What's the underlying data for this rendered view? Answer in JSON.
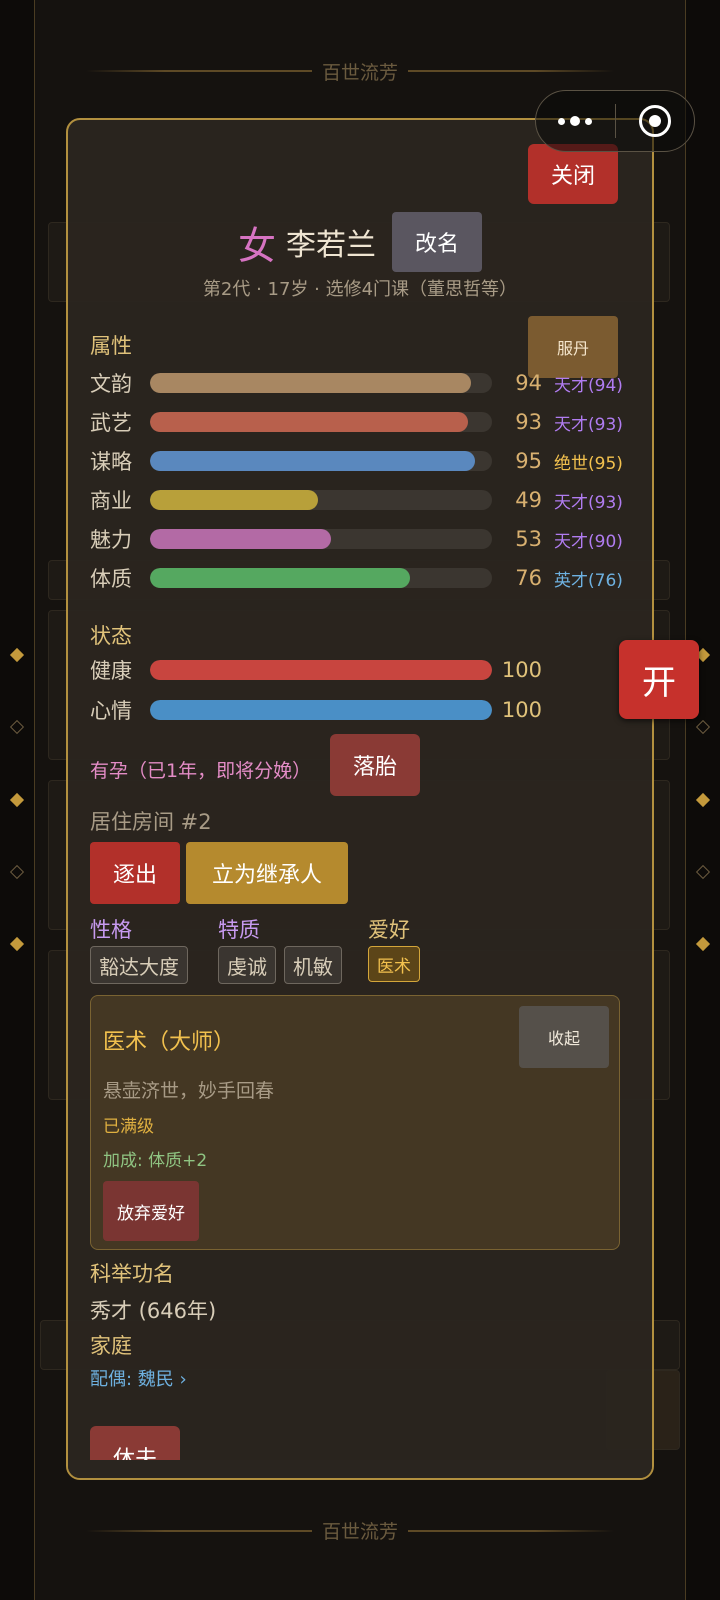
{
  "background": {
    "title_top": "百世流芳",
    "title_bottom": "百世流芳"
  },
  "open_button": {
    "label": "开"
  },
  "modal": {
    "close_label": "关闭",
    "gender": "女",
    "name": "李若兰",
    "rename_label": "改名",
    "subinfo": "第2代 · 17岁 · 选修4门课（董思哲等）",
    "attributes_label": "属性",
    "pill_label": "服丹",
    "attributes": [
      {
        "name": "文韵",
        "value": "94",
        "fill": 0.94,
        "color": "#a88762",
        "tag": "天才(94)",
        "tag_color": "#b07cf0"
      },
      {
        "name": "武艺",
        "value": "93",
        "fill": 0.93,
        "color": "#b8604c",
        "tag": "天才(93)",
        "tag_color": "#b07cf0"
      },
      {
        "name": "谋略",
        "value": "95",
        "fill": 0.95,
        "color": "#5a88be",
        "tag": "绝世(95)",
        "tag_color": "#f2c14e"
      },
      {
        "name": "商业",
        "value": "49",
        "fill": 0.49,
        "color": "#b8a03a",
        "tag": "天才(93)",
        "tag_color": "#b07cf0"
      },
      {
        "name": "魅力",
        "value": "53",
        "fill": 0.53,
        "color": "#b36aa5",
        "tag": "天才(90)",
        "tag_color": "#b07cf0"
      },
      {
        "name": "体质",
        "value": "76",
        "fill": 0.76,
        "color": "#55a860",
        "tag": "英才(76)",
        "tag_color": "#6eb1e0"
      }
    ],
    "status_label": "状态",
    "status": [
      {
        "name": "健康",
        "value": "100",
        "fill": 1.0,
        "color": "#c8453f"
      },
      {
        "name": "心情",
        "value": "100",
        "fill": 1.0,
        "color": "#4a8fc6"
      }
    ],
    "pregnancy": "有孕（已1年，即将分娩）",
    "abort_label": "落胎",
    "room": "居住房间 #2",
    "expel_label": "逐出",
    "heir_label": "立为继承人",
    "personality_label": "性格",
    "traits_label": "特质",
    "hobby_label": "爱好",
    "personality": [
      "豁达大度"
    ],
    "traits": [
      "虔诚",
      "机敏"
    ],
    "hobbies": [
      "医术"
    ],
    "hobby_card": {
      "title": "医术（大师）",
      "collapse_label": "收起",
      "description": "悬壶济世，妙手回春",
      "maxed": "已满级",
      "bonus": "加成: 体质+2",
      "abandon_label": "放弃爱好"
    },
    "exam_label": "科举功名",
    "exam_value": "秀才 (646年)",
    "family_label": "家庭",
    "spouse": "配偶: 魏民 ›",
    "divorce_label": "休夫"
  }
}
